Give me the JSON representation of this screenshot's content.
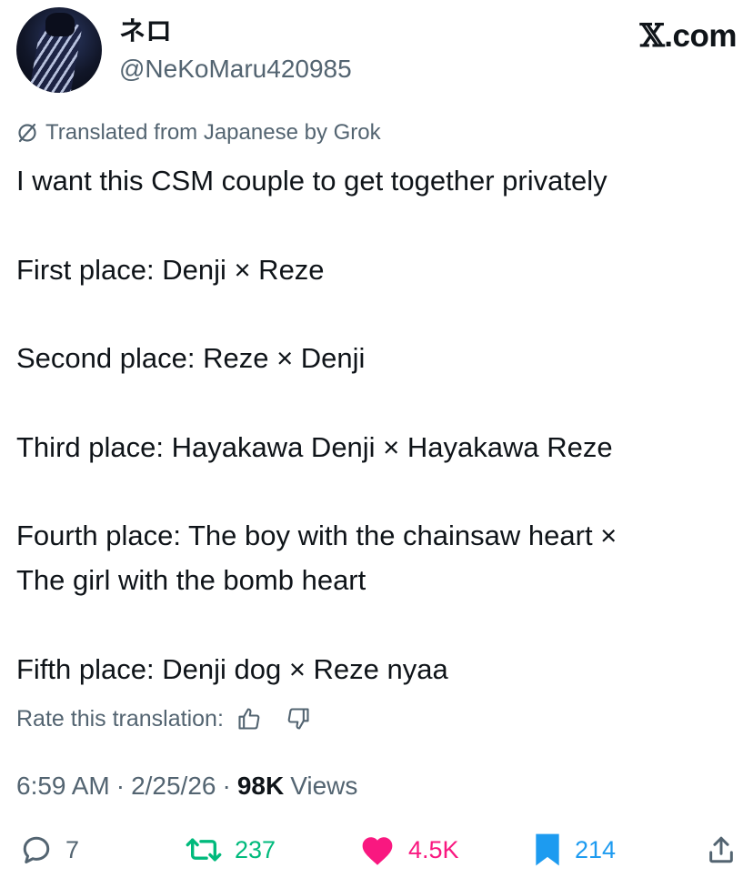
{
  "header": {
    "display_name": "ネロ",
    "handle": "@NeKoMaru420985",
    "site_brand_x": "𝕏",
    "site_brand_suffix": ".com"
  },
  "translation_notice": "Translated from Japanese by Grok",
  "tweet": {
    "lines": [
      "I want this CSM couple to get together privately",
      "First place: Denji × Reze",
      "Second place: Reze × Denji",
      "Third place: Hayakawa Denji × Hayakawa Reze",
      "Fourth place: The boy with the chainsaw heart ×",
      "The girl with the bomb heart",
      "Fifth place: Denji dog × Reze nyaa"
    ]
  },
  "rate_translation": {
    "label": "Rate this translation:",
    "icons": [
      "thumbs-up-icon",
      "thumbs-down-icon"
    ]
  },
  "meta": {
    "time": "6:59 AM",
    "date": "2/25/26",
    "separator": "·",
    "views_count": "98K",
    "views_label": "Views"
  },
  "actions": {
    "replies": "7",
    "reposts": "237",
    "likes": "4.5K",
    "bookmarks": "214"
  },
  "colors": {
    "text": "#0f1419",
    "secondary": "#536471",
    "repost": "#00ba7c",
    "like": "#f91880",
    "bookmark": "#1d9bf0"
  }
}
